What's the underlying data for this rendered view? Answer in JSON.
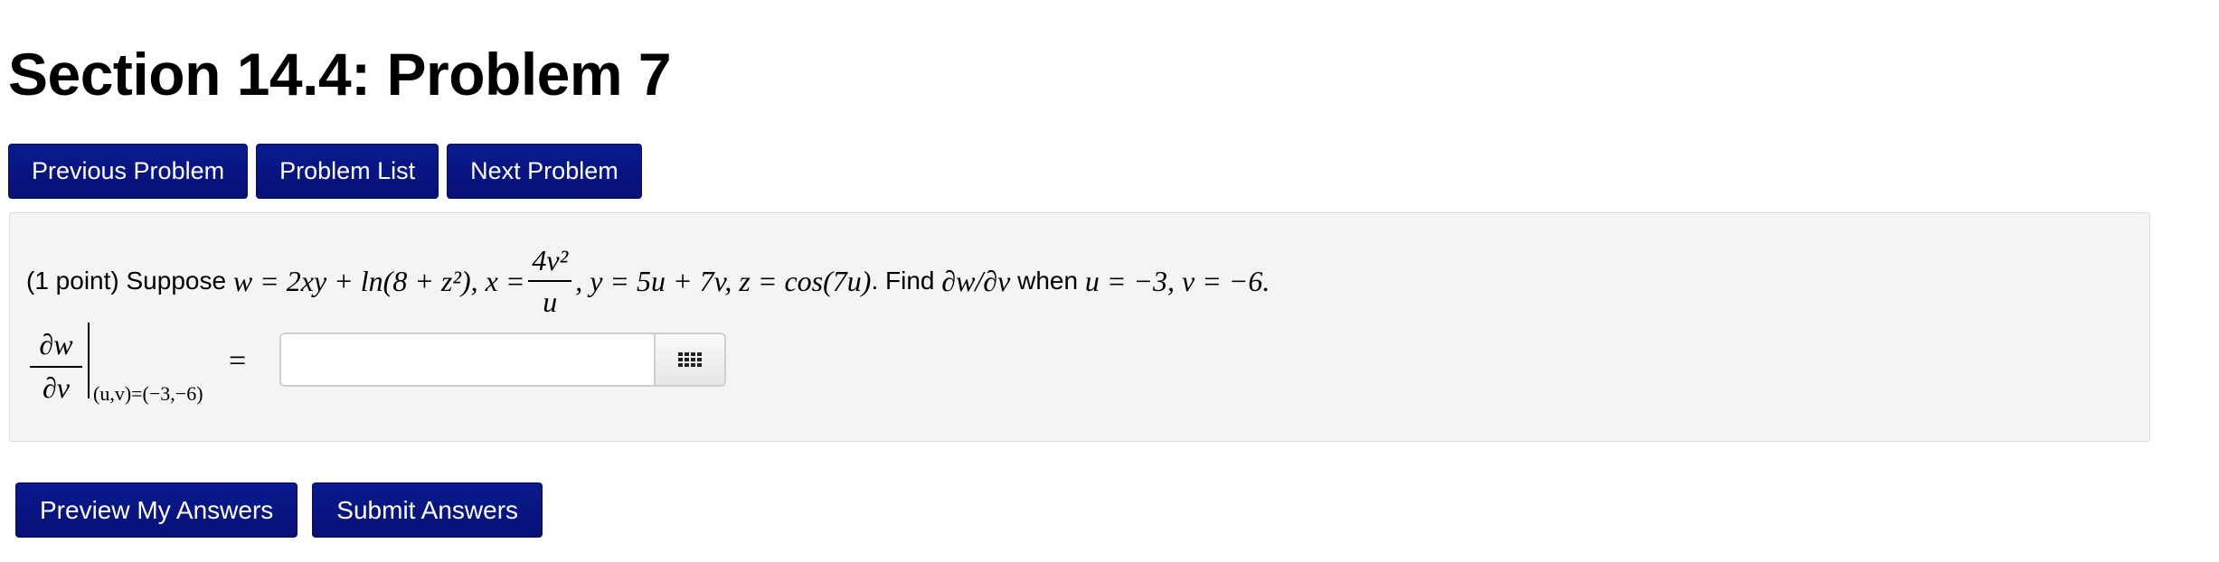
{
  "page": {
    "title": "Section 14.4: Problem 7"
  },
  "nav": {
    "previous": "Previous Problem",
    "list": "Problem List",
    "next": "Next Problem"
  },
  "problem": {
    "points": "(1 point) Suppose",
    "w_eq": "w = 2xy + ln(8 + z²)",
    "x_eq_prefix": ", x =",
    "x_num": "4v²",
    "x_den": "u",
    "rest": ", y = 5u + 7v, z = cos(7u)",
    "find_text": ". Find",
    "target": "∂w/∂v",
    "when_text": "when",
    "condition": "u = −3, v = −6."
  },
  "answer": {
    "deriv_num": "∂w",
    "deriv_den": "∂v",
    "eval_at": "(u,v)=(−3,−6)",
    "equals": "=",
    "value": "",
    "keypad_icon": "keypad-grid-icon"
  },
  "actions": {
    "preview": "Preview My Answers",
    "submit": "Submit Answers"
  },
  "colors": {
    "button_bg": "#08137f",
    "button_text": "#ffffff",
    "panel_bg": "#f4f4f4",
    "panel_border": "#dcdcdc"
  }
}
